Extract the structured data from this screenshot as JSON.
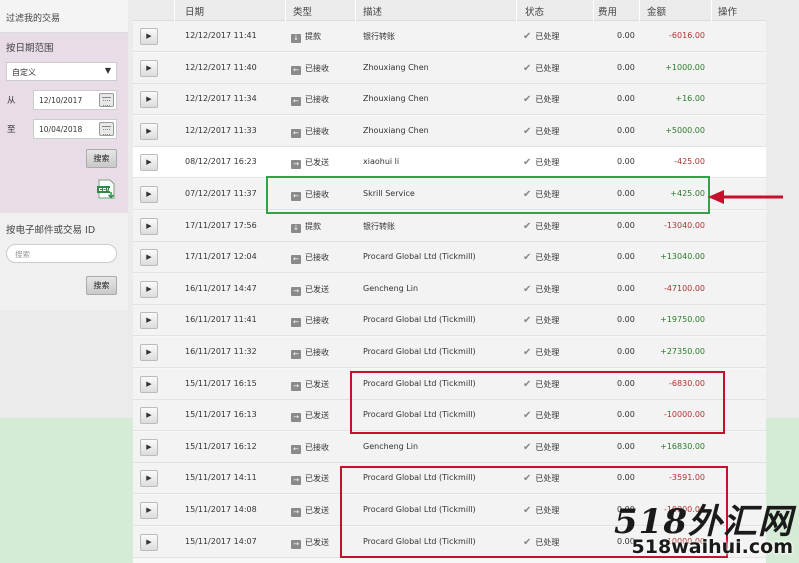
{
  "sidebar": {
    "header": "过滤我的交易",
    "date_range_title": "按日期范围",
    "range_select": "自定义",
    "from_label": "从",
    "from_value": "12/10/2017",
    "to_label": "至",
    "to_value": "10/04/2018",
    "search_button": "搜索",
    "email_title": "按电子邮件或交易 ID",
    "email_placeholder": "搜索",
    "email_search_button": "搜索"
  },
  "table": {
    "columns": [
      "日期",
      "类型",
      "描述",
      "状态",
      "费用",
      "金额",
      "操作"
    ],
    "rows": [
      {
        "date": "12/12/2017 11:41",
        "type": "提款",
        "desc": "银行转账",
        "status": "已处理",
        "fee": "0.00",
        "amount": "-6016.00",
        "sign": "neg",
        "icon": "down-arrow-icon"
      },
      {
        "date": "12/12/2017 11:40",
        "type": "已接收",
        "desc": "Zhouxiang Chen",
        "status": "已处理",
        "fee": "0.00",
        "amount": "+1000.00",
        "sign": "pos",
        "icon": "left-arrow-icon"
      },
      {
        "date": "12/12/2017 11:34",
        "type": "已接收",
        "desc": "Zhouxiang Chen",
        "status": "已处理",
        "fee": "0.00",
        "amount": "+16.00",
        "sign": "pos",
        "icon": "left-arrow-icon"
      },
      {
        "date": "12/12/2017 11:33",
        "type": "已接收",
        "desc": "Zhouxiang Chen",
        "status": "已处理",
        "fee": "0.00",
        "amount": "+5000.00",
        "sign": "pos",
        "icon": "left-arrow-icon"
      },
      {
        "date": "08/12/2017 16:23",
        "type": "已发送",
        "desc": "xiaohui li",
        "status": "已处理",
        "fee": "0.00",
        "amount": "-425.00",
        "sign": "neg",
        "icon": "right-arrow-icon"
      },
      {
        "date": "07/12/2017 11:37",
        "type": "已接收",
        "desc": "Skrill Service",
        "status": "已处理",
        "fee": "0.00",
        "amount": "+425.00",
        "sign": "pos",
        "icon": "left-arrow-icon"
      },
      {
        "date": "17/11/2017 17:56",
        "type": "提款",
        "desc": "银行转账",
        "status": "已处理",
        "fee": "0.00",
        "amount": "-13040.00",
        "sign": "neg",
        "icon": "down-arrow-icon"
      },
      {
        "date": "17/11/2017 12:04",
        "type": "已接收",
        "desc": "Procard Global Ltd (Tickmill)",
        "status": "已处理",
        "fee": "0.00",
        "amount": "+13040.00",
        "sign": "pos",
        "icon": "left-arrow-icon"
      },
      {
        "date": "16/11/2017 14:47",
        "type": "已发送",
        "desc": "Gencheng Lin",
        "status": "已处理",
        "fee": "0.00",
        "amount": "-47100.00",
        "sign": "neg",
        "icon": "right-arrow-icon"
      },
      {
        "date": "16/11/2017 11:41",
        "type": "已接收",
        "desc": "Procard Global Ltd (Tickmill)",
        "status": "已处理",
        "fee": "0.00",
        "amount": "+19750.00",
        "sign": "pos",
        "icon": "left-arrow-icon"
      },
      {
        "date": "16/11/2017 11:32",
        "type": "已接收",
        "desc": "Procard Global Ltd (Tickmill)",
        "status": "已处理",
        "fee": "0.00",
        "amount": "+27350.00",
        "sign": "pos",
        "icon": "left-arrow-icon"
      },
      {
        "date": "15/11/2017 16:15",
        "type": "已发送",
        "desc": "Procard Global Ltd (Tickmill)",
        "status": "已处理",
        "fee": "0.00",
        "amount": "-6830.00",
        "sign": "neg",
        "icon": "right-arrow-icon"
      },
      {
        "date": "15/11/2017 16:13",
        "type": "已发送",
        "desc": "Procard Global Ltd (Tickmill)",
        "status": "已处理",
        "fee": "0.00",
        "amount": "-10000.00",
        "sign": "neg",
        "icon": "right-arrow-icon"
      },
      {
        "date": "15/11/2017 16:12",
        "type": "已接收",
        "desc": "Gencheng Lin",
        "status": "已处理",
        "fee": "0.00",
        "amount": "+16830.00",
        "sign": "pos",
        "icon": "left-arrow-icon"
      },
      {
        "date": "15/11/2017 14:11",
        "type": "已发送",
        "desc": "Procard Global Ltd (Tickmill)",
        "status": "已处理",
        "fee": "0.00",
        "amount": "-3591.00",
        "sign": "neg",
        "icon": "right-arrow-icon"
      },
      {
        "date": "15/11/2017 14:08",
        "type": "已发送",
        "desc": "Procard Global Ltd (Tickmill)",
        "status": "已处理",
        "fee": "0.00",
        "amount": "-10000.00",
        "sign": "neg",
        "icon": "right-arrow-icon"
      },
      {
        "date": "15/11/2017 14:07",
        "type": "已发送",
        "desc": "Procard Global Ltd (Tickmill)",
        "status": "已处理",
        "fee": "0.00",
        "amount": "-10000.00",
        "sign": "neg",
        "icon": "right-arrow-icon"
      }
    ]
  },
  "watermark": {
    "top": "518外汇网",
    "bottom": "518waihui.com"
  },
  "colors": {
    "highlight_green": "#33a04a",
    "highlight_red": "#c8102e",
    "negative_amount": "#b03434",
    "positive_amount": "#2d7a2d"
  }
}
